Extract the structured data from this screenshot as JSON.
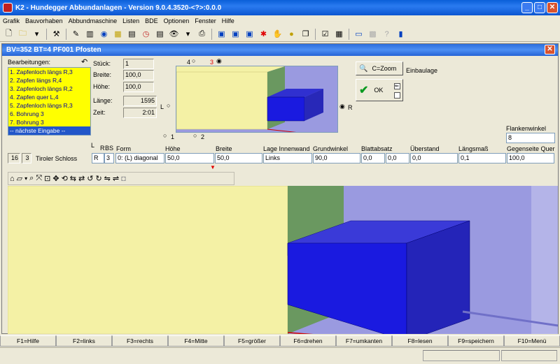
{
  "window": {
    "title": "K2 - Hundegger Abbundanlagen - Version 9.0.4.3520-<?>:0.0.0"
  },
  "menu": [
    "Grafik",
    "Bauvorhaben",
    "Abbundmaschine",
    "Listen",
    "BDE",
    "Optionen",
    "Fenster",
    "Hilfe"
  ],
  "child": {
    "title": "BV=352  BT=4 PF001 Pfosten"
  },
  "operations": {
    "label": "Bearbeitungen:",
    "items": [
      "1. Zapfenloch längs R,3",
      "2. Zapfen längs R,4",
      "3. Zapfenloch längs R,2",
      "4. Zapfen quer L,4",
      "5. Zapfenloch längs R,3",
      "6. Bohrung 3",
      "7. Bohrung 3",
      "-- nächste Eingabe --"
    ]
  },
  "props": {
    "stueck_label": "Stück:",
    "stueck": "1",
    "breite_label": "Breite:",
    "breite": "100,0",
    "hoehe_label": "Höhe:",
    "hoehe": "100,0",
    "laenge_label": "Länge:",
    "laenge": "1595",
    "zeit_label": "Zeit:",
    "zeit": "2:01"
  },
  "preview": {
    "opt4": "4",
    "opt3": "3",
    "optL": "L",
    "optR": "R",
    "opt1": "1",
    "opt2": "2"
  },
  "buttons": {
    "zoom": "C=Zoom",
    "ok": "OK",
    "einbaulage": "Einbaulage"
  },
  "flanken": {
    "label": "Flankenwinkel",
    "value": "8"
  },
  "row": {
    "num1": "16",
    "num2": "3",
    "name": "Tiroler Schloss",
    "lbs": "L",
    "rbs": "R",
    "bs": "BS",
    "r_val": "R",
    "three_val": "3",
    "headers": [
      "Form",
      "Höhe",
      "Breite",
      "Lage Innenwand",
      "Grundwinkel",
      "Blattabsatz",
      "Überstand",
      "Längsmaß",
      "Gegenseite Quer"
    ],
    "form": "0: (L) diagonal",
    "hoehe": "50,0",
    "breite": "50,0",
    "lage": "Links",
    "grundwinkel": "90,0",
    "blatt1": "0,0",
    "blatt2": "0,0",
    "ueberstand": "0,0",
    "laengsmass": "0,1",
    "gegenseite": "100,0"
  },
  "fkeys": [
    "F1=Hilfe",
    "F2=links",
    "F3=rechts",
    "F4=Mitte",
    "F5=größer",
    "F6=drehen",
    "F7=umkanten",
    "F8=lesen",
    "F9=speichern",
    "F10=Menü"
  ],
  "colors": {
    "beam_yellow": "#f4f1a5",
    "beam_green": "#6a9860",
    "box_blue": "#1a1ae0",
    "background_lavender": "#9a9ae0"
  }
}
